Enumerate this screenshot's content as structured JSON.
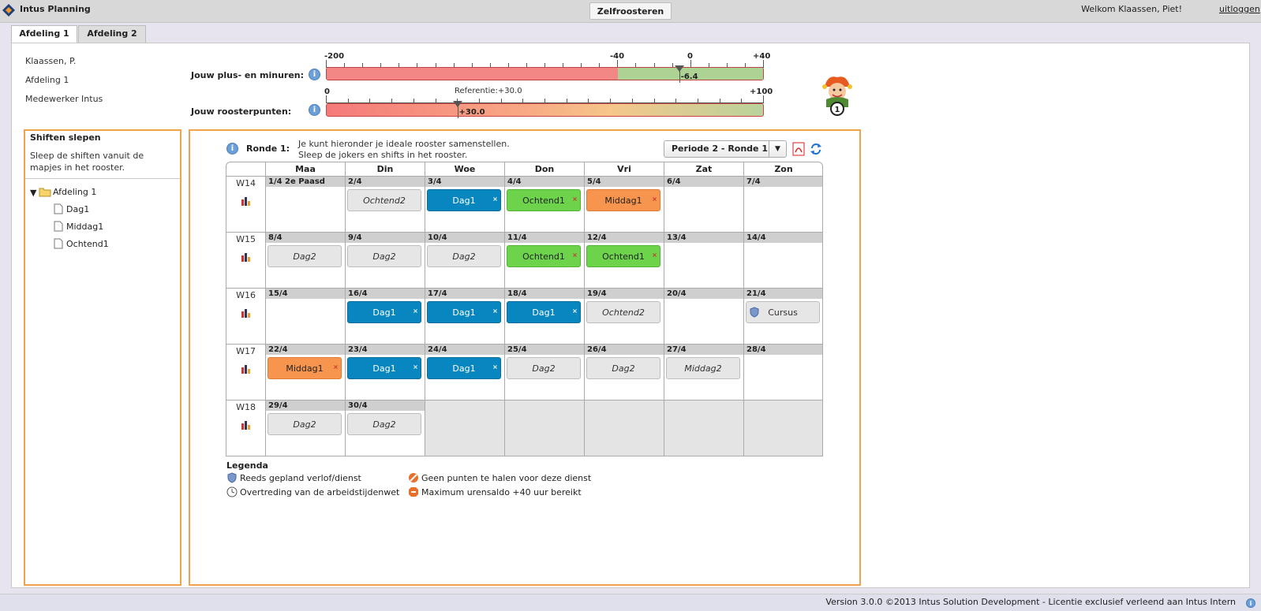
{
  "app": {
    "title": "Intus Planning",
    "top_tab": "Zelfroosteren",
    "welcome": "Welkom Klaassen, Piet!",
    "logout": "uitloggen"
  },
  "tabs": [
    "Afdeling 1",
    "Afdeling 2"
  ],
  "employee": {
    "name": "Klaassen, P.",
    "department": "Afdeling 1",
    "role": "Medewerker Intus"
  },
  "plus_min": {
    "label": "Jouw plus- en minuren:",
    "scale": [
      "-200",
      "-40",
      "0",
      "+40"
    ],
    "min": -200,
    "max": 40,
    "threshold": -40,
    "value": -6.4,
    "value_label": "-6.4"
  },
  "roosterpunten": {
    "label": "Jouw roosterpunten:",
    "scale": [
      "0",
      "+100"
    ],
    "min": 0,
    "max": 100,
    "value": 30,
    "value_label": "+30.0",
    "reference": "Referentie:+30.0"
  },
  "joker": {
    "count": "1"
  },
  "left": {
    "title": "Shiften slepen",
    "desc": "Sleep de shiften vanuit de mapjes in het rooster.",
    "folder": "Afdeling 1",
    "items": [
      "Dag1",
      "Middag1",
      "Ochtend1"
    ]
  },
  "ronde": {
    "label": "Ronde 1:",
    "line1": "Je kunt hieronder je ideale rooster samenstellen.",
    "line2": "Sleep de jokers en shifts in het rooster.",
    "periode": "Periode 2 - Ronde 1"
  },
  "calendar": {
    "days": [
      "Maa",
      "Din",
      "Woe",
      "Don",
      "Vri",
      "Zat",
      "Zon"
    ],
    "weeks": [
      {
        "week": "W14",
        "cells": [
          {
            "date": "1/4 2e Paasd",
            "shift": null,
            "type": null
          },
          {
            "date": "2/4",
            "shift": "Ochtend2",
            "type": "grey"
          },
          {
            "date": "3/4",
            "shift": "Dag1",
            "type": "blue"
          },
          {
            "date": "4/4",
            "shift": "Ochtend1",
            "type": "green"
          },
          {
            "date": "5/4",
            "shift": "Middag1",
            "type": "orange"
          },
          {
            "date": "6/4",
            "shift": null,
            "type": null
          },
          {
            "date": "7/4",
            "shift": null,
            "type": null
          }
        ]
      },
      {
        "week": "W15",
        "cells": [
          {
            "date": "8/4",
            "shift": "Dag2",
            "type": "grey"
          },
          {
            "date": "9/4",
            "shift": "Dag2",
            "type": "grey"
          },
          {
            "date": "10/4",
            "shift": "Dag2",
            "type": "grey"
          },
          {
            "date": "11/4",
            "shift": "Ochtend1",
            "type": "green"
          },
          {
            "date": "12/4",
            "shift": "Ochtend1",
            "type": "green"
          },
          {
            "date": "13/4",
            "shift": null,
            "type": null
          },
          {
            "date": "14/4",
            "shift": null,
            "type": null
          }
        ]
      },
      {
        "week": "W16",
        "cells": [
          {
            "date": "15/4",
            "shift": null,
            "type": null
          },
          {
            "date": "16/4",
            "shift": "Dag1",
            "type": "blue"
          },
          {
            "date": "17/4",
            "shift": "Dag1",
            "type": "blue"
          },
          {
            "date": "18/4",
            "shift": "Dag1",
            "type": "blue"
          },
          {
            "date": "19/4",
            "shift": "Ochtend2",
            "type": "grey"
          },
          {
            "date": "20/4",
            "shift": null,
            "type": null
          },
          {
            "date": "21/4",
            "shift": "Cursus",
            "type": "cursus"
          }
        ]
      },
      {
        "week": "W17",
        "cells": [
          {
            "date": "22/4",
            "shift": "Middag1",
            "type": "orange"
          },
          {
            "date": "23/4",
            "shift": "Dag1",
            "type": "blue"
          },
          {
            "date": "24/4",
            "shift": "Dag1",
            "type": "blue"
          },
          {
            "date": "25/4",
            "shift": "Dag2",
            "type": "grey"
          },
          {
            "date": "26/4",
            "shift": "Dag2",
            "type": "grey"
          },
          {
            "date": "27/4",
            "shift": "Middag2",
            "type": "grey"
          },
          {
            "date": "28/4",
            "shift": null,
            "type": null
          }
        ]
      },
      {
        "week": "W18",
        "cells": [
          {
            "date": "29/4",
            "shift": "Dag2",
            "type": "grey"
          },
          {
            "date": "30/4",
            "shift": "Dag2",
            "type": "grey"
          },
          {
            "date": null,
            "shift": null,
            "type": "off"
          },
          {
            "date": null,
            "shift": null,
            "type": "off"
          },
          {
            "date": null,
            "shift": null,
            "type": "off"
          },
          {
            "date": null,
            "shift": null,
            "type": "off"
          },
          {
            "date": null,
            "shift": null,
            "type": "off"
          }
        ]
      }
    ]
  },
  "legend": {
    "title": "Legenda",
    "items": [
      "Reeds gepland verlof/dienst",
      "Overtreding van de arbeidstijdenwet",
      "Geen punten te halen voor deze dienst",
      "Maximum urensaldo +40 uur bereikt"
    ]
  },
  "footer": {
    "version": "Version 3.0.0 ©2013 Intus Solution Development - Licentie exclusief verleend aan Intus Intern"
  },
  "colors": {
    "blue": "#0886bf",
    "green": "#6cd34a",
    "orange": "#f7944d",
    "grey": "#e6e6e6",
    "accent": "#f2a24b"
  }
}
